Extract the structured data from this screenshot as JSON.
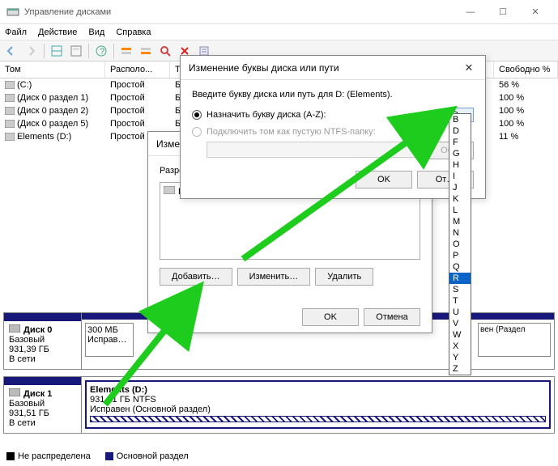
{
  "window": {
    "title": "Управление дисками",
    "menu": {
      "file": "Файл",
      "action": "Действие",
      "view": "Вид",
      "help": "Справка"
    },
    "winbtns": {
      "min": "—",
      "max": "☐",
      "close": "✕"
    }
  },
  "grid": {
    "headers": {
      "vol": "Том",
      "layout": "Располо...",
      "type": "Ти...",
      "free": "Свободно %"
    },
    "rows": [
      {
        "vol": "(C:)",
        "layout": "Простой",
        "type": "Ба",
        "free": "56 %"
      },
      {
        "vol": "(Диск 0 раздел 1)",
        "layout": "Простой",
        "type": "Ба",
        "free": "100 %"
      },
      {
        "vol": "(Диск 0 раздел 2)",
        "layout": "Простой",
        "type": "Ба",
        "free": "100 %"
      },
      {
        "vol": "(Диск 0 раздел 5)",
        "layout": "Простой",
        "type": "Ба",
        "free": "100 %"
      },
      {
        "vol": "Elements (D:)",
        "layout": "Простой",
        "type": "Ба",
        "free": "11 %"
      }
    ]
  },
  "disks": [
    {
      "name": "Диск 0",
      "type": "Базовый",
      "size": "931,39 ГБ",
      "status": "В сети",
      "part": {
        "header": "300 МБ",
        "sub": "Исправ…",
        "tail": "вен (Раздел"
      }
    },
    {
      "name": "Диск 1",
      "type": "Базовый",
      "size": "931,51 ГБ",
      "status": "В сети",
      "part": {
        "header": "Elements (D:)",
        "sub": "931,51 ГБ NTFS",
        "desc": "Исправен (Основной раздел)"
      }
    }
  ],
  "legend": {
    "unalloc": "Не распределена",
    "primary": "Основной раздел"
  },
  "dlg1": {
    "title": "Изменение",
    "text": "Разрешить",
    "drive": "D:",
    "add": "Добавить…",
    "change": "Изменить…",
    "remove": "Удалить",
    "ok": "OK",
    "cancel": "Отмена"
  },
  "dlg2": {
    "title": "Изменение буквы диска или пути",
    "prompt": "Введите букву диска или путь для D: (Elements).",
    "opt1": "Назначить букву диска (A-Z):",
    "opt2": "Подключить том как пустую NTFS-папку:",
    "browse": "Об…",
    "selected": "D",
    "ok": "OK",
    "cancel": "От…"
  },
  "dropdown": {
    "letters": [
      "B",
      "D",
      "F",
      "G",
      "H",
      "I",
      "J",
      "K",
      "L",
      "M",
      "N",
      "O",
      "P",
      "Q",
      "R",
      "S",
      "T",
      "U",
      "V",
      "W",
      "X",
      "Y",
      "Z"
    ],
    "highlight": "R"
  }
}
